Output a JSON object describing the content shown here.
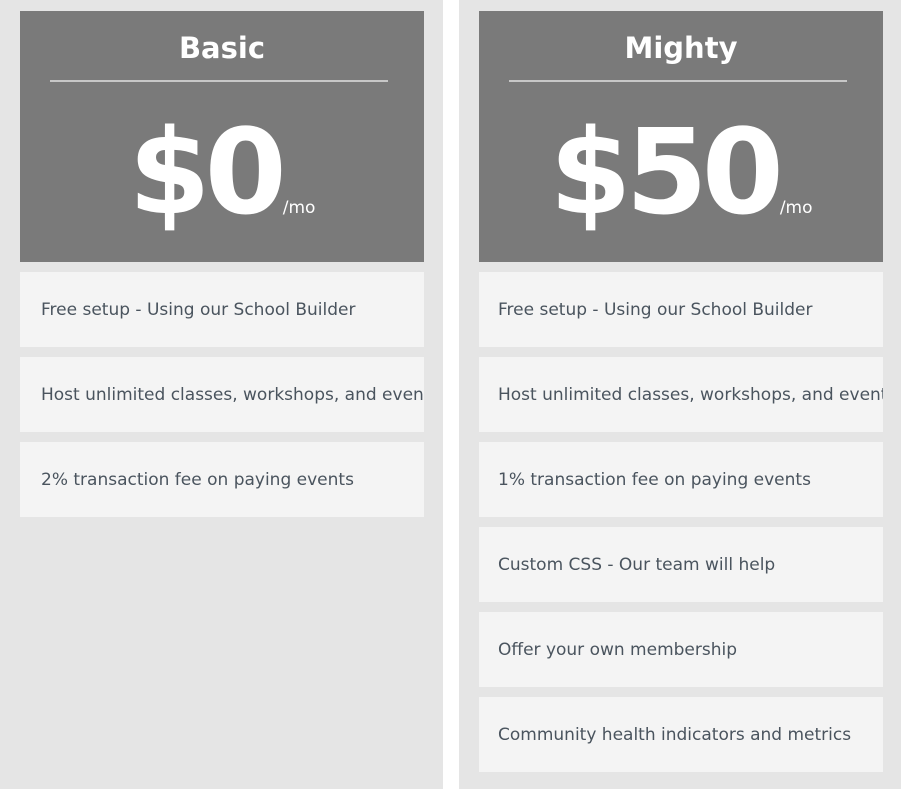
{
  "plans": [
    {
      "name": "Basic",
      "price": "$0",
      "period": "/mo",
      "features": [
        "Free setup - Using our School Builder",
        "Host unlimited classes, workshops, and events",
        "2% transaction fee on paying events"
      ]
    },
    {
      "name": "Mighty",
      "price": "$50",
      "period": "/mo",
      "features": [
        "Free setup - Using our School Builder",
        "Host unlimited classes, workshops, and events",
        "1% transaction fee on paying events",
        "Custom CSS - Our team will help",
        "Offer your own membership",
        "Community health indicators and metrics"
      ]
    }
  ],
  "colors": {
    "header_bg": "#7a7a7a",
    "column_bg": "#e5e5e5",
    "feature_bg": "#f4f4f4",
    "feature_text": "#4a545e"
  }
}
